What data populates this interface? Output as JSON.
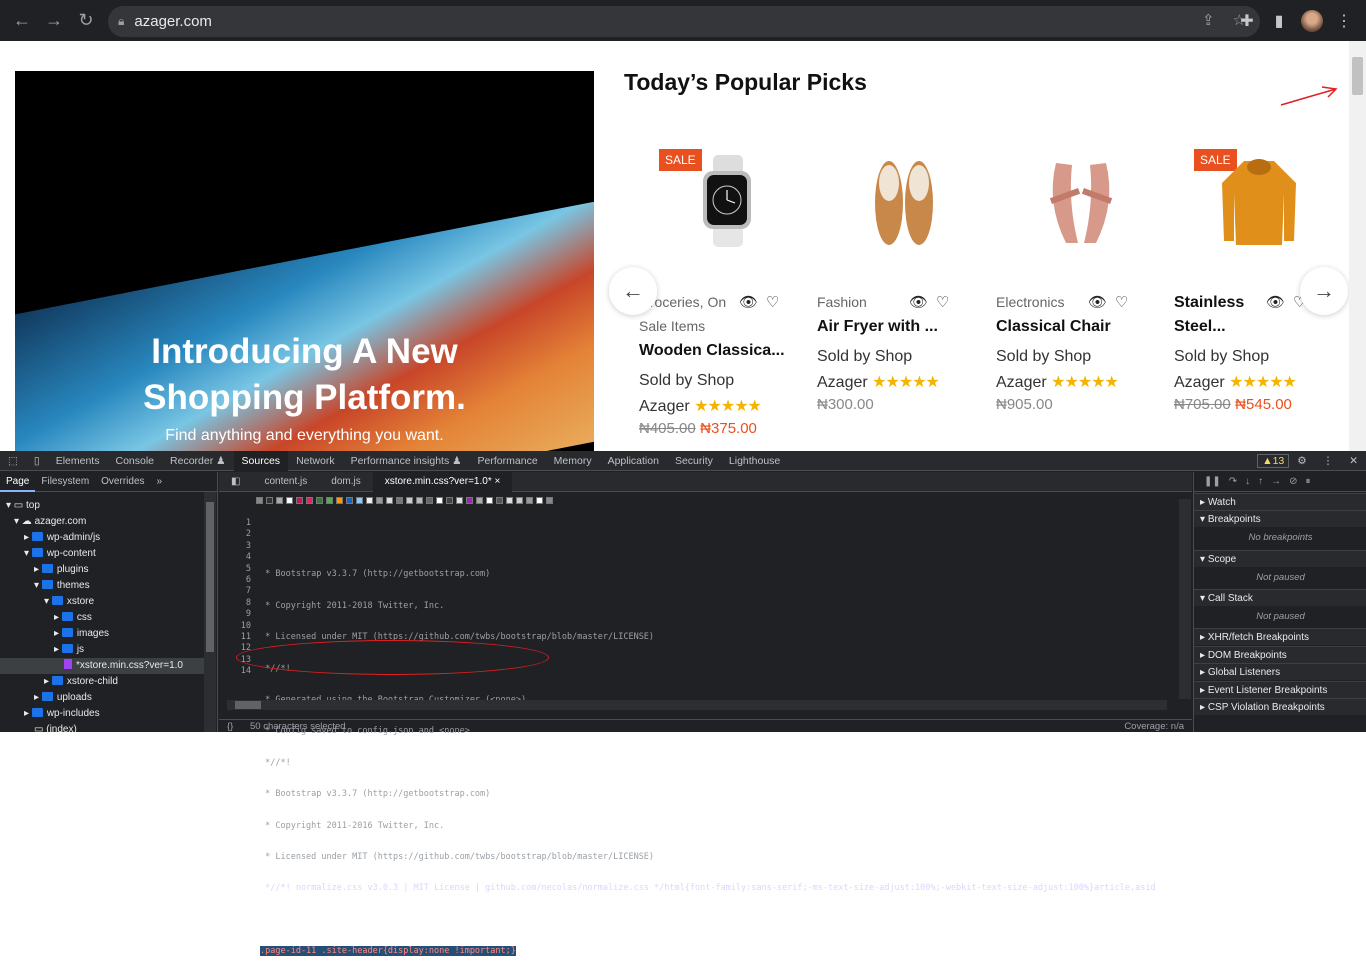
{
  "browser": {
    "url": "azager.com",
    "back_icon": "arrow-left-icon",
    "forward_icon": "arrow-right-icon",
    "reload_icon": "reload-icon"
  },
  "page": {
    "hero": {
      "title_line1": "Introducing A New",
      "title_line2": "Shopping Platform.",
      "subtitle": "Find anything and everything you want."
    },
    "picks_title": "Today’s Popular Picks",
    "products": [
      {
        "sale": "SALE",
        "category": "Groceries, On",
        "subcategory": "Sale Items",
        "name": "Wooden Classica...",
        "seller1": "Sold by Shop",
        "seller2": "Azager",
        "old_price": "₦405.00",
        "price": "₦375.00"
      },
      {
        "sale": "",
        "category": "Fashion",
        "subcategory": "",
        "name": "Air Fryer with ...",
        "seller1": "Sold by Shop",
        "seller2": "Azager",
        "old_price": "",
        "price": "₦300.00"
      },
      {
        "sale": "",
        "category": "Electronics",
        "subcategory": "",
        "name": "Classical Chair",
        "seller1": "Sold by Shop",
        "seller2": "Azager",
        "old_price": "",
        "price": "₦905.00"
      },
      {
        "sale": "SALE",
        "category": "",
        "subcategory": "",
        "name": "Stainless",
        "name2": "Steel...",
        "seller1": "Sold by Shop",
        "seller2": "Azager",
        "old_price": "₦705.00",
        "price": "₦545.00"
      }
    ],
    "rating_stars": "★★★★★"
  },
  "devtools": {
    "tabs": [
      "Elements",
      "Console",
      "Recorder ♟",
      "Sources",
      "Network",
      "Performance insights ♟",
      "Performance",
      "Memory",
      "Application",
      "Security",
      "Lighthouse"
    ],
    "warnings": "▲13",
    "left_tabs": [
      "Page",
      "Filesystem",
      "Overrides",
      "»"
    ],
    "tree": [
      "top",
      "azager.com",
      "wp-admin/js",
      "wp-content",
      "plugins",
      "themes",
      "xstore",
      "css",
      "images",
      "js",
      "*xstore.min.css?ver=1.0",
      "xstore-child",
      "uploads",
      "wp-includes",
      "(index)"
    ],
    "editor_tabs": [
      "content.js",
      "dom.js",
      "xstore.min.css?ver=1.0* ×"
    ],
    "code_lines": [
      "",
      " * Bootstrap v3.3.7 (http://getbootstrap.com)",
      " * Copyright 2011-2018 Twitter, Inc.",
      " * Licensed under MIT (https://github.com/twbs/bootstrap/blob/master/LICENSE)",
      " *//*!",
      " * Generated using the Bootstrap Customizer (<none>)",
      " * Config saved to config.json and <none>",
      " *//*!",
      " * Bootstrap v3.3.7 (http://getbootstrap.com)",
      " * Copyright 2011-2016 Twitter, Inc.",
      " * Licensed under MIT (https://github.com/twbs/bootstrap/blob/master/LICENSE)",
      " *//*! normalize.css v3.0.3 | MIT License | github.com/necolas/normalize.css */html{font-family:sans-serif;-ms-text-size-adjust:100%;-webkit-text-size-adjust:100%}article,asid",
      "",
      ".page-id-11 .site-header{display:none !important;}"
    ],
    "status_left": "50 characters selected",
    "status_right": "Coverage: n/a",
    "right_sections": [
      "Watch",
      "Breakpoints",
      "No breakpoints",
      "Scope",
      "Not paused",
      "Call Stack",
      "Not paused",
      "XHR/fetch Breakpoints",
      "DOM Breakpoints",
      "Global Listeners",
      "Event Listener Breakpoints",
      "CSP Violation Breakpoints"
    ]
  }
}
